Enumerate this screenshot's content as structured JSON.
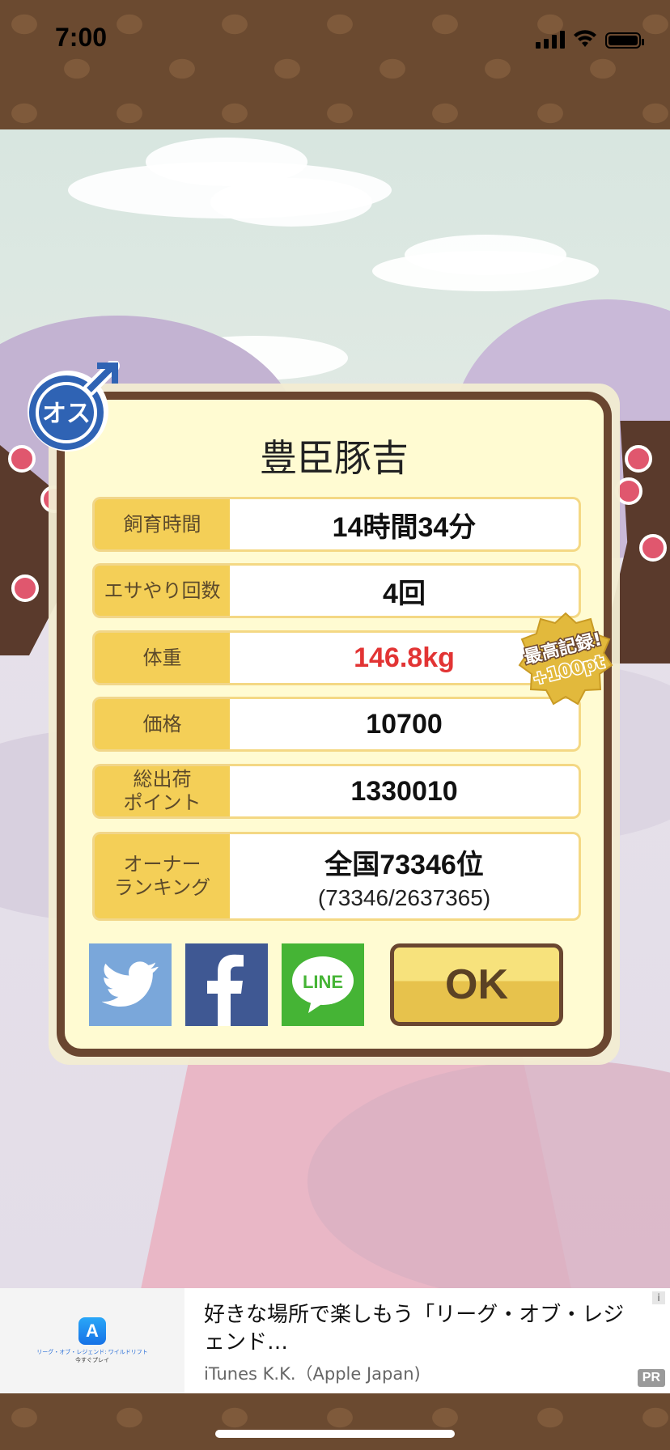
{
  "status_bar": {
    "time": "7:00"
  },
  "dialog": {
    "gender_badge_text": "オス",
    "title": "豊臣豚吉",
    "rows": [
      {
        "label": "飼育時間",
        "value": "14時間34分"
      },
      {
        "label": "エサやり回数",
        "value": "4回"
      },
      {
        "label": "体重",
        "value": "146.8kg"
      },
      {
        "label": "価格",
        "value": "10700"
      },
      {
        "label": "総出荷\nポイント",
        "value": "1330010"
      }
    ],
    "ranking": {
      "label": "オーナー\nランキング",
      "value": "全国73346位",
      "detail": "(73346/2637365)"
    },
    "record_badge": {
      "line1": "最高記録!",
      "line2": "+100pt"
    },
    "buttons": {
      "twitter_icon": "twitter-icon",
      "facebook_icon": "facebook-icon",
      "line_label": "LINE",
      "ok_label": "OK"
    }
  },
  "ad": {
    "app_caption": "リーグ・オブ・レジェンド: ワイルドリフト",
    "app_cta": "今すぐプレイ",
    "title": "好きな場所で楽しもう「リーグ・オブ・レジェンド…",
    "advertiser": "iTunes K.K.（Apple Japan)",
    "pr_label": "PR",
    "info_label": "i"
  },
  "colors": {
    "accent_gold": "#f4cf57",
    "frame_brown": "#6a4630",
    "weight_red": "#e23434"
  }
}
